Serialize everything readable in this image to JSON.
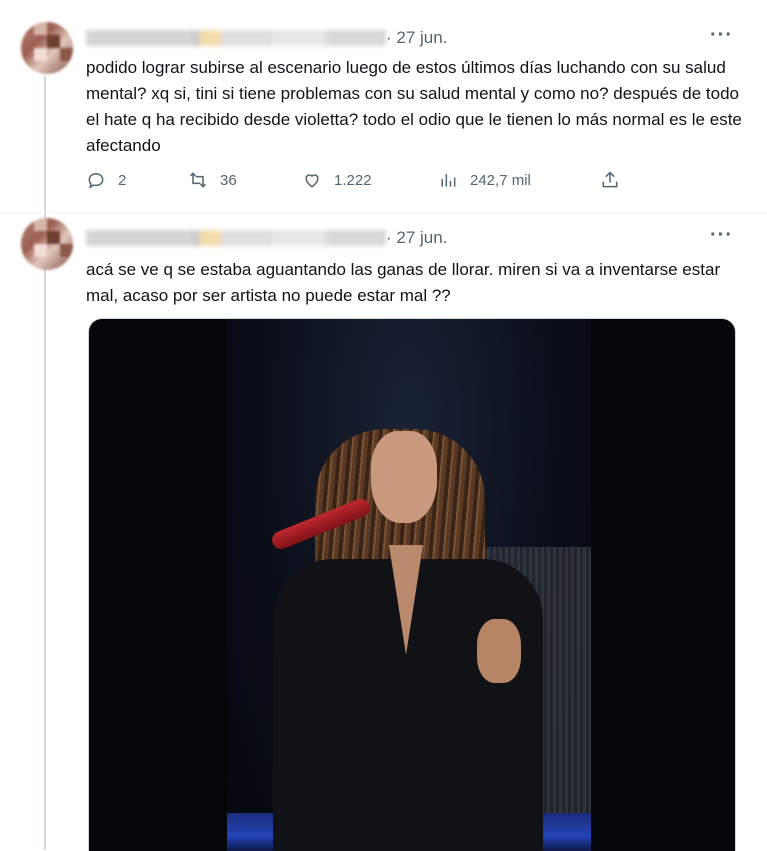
{
  "tweets": [
    {
      "date": "· 27 jun.",
      "more": "···",
      "text": "podido lograr subirse al escenario luego de estos últimos días luchando con su salud mental? xq si, tini si tiene problemas con su salud mental y como no? después de todo el hate q ha recibido desde violetta? todo el odio que le tienen lo más normal es le este afectando",
      "stats": {
        "replies": "2",
        "retweets": "36",
        "likes": "1.222",
        "views": "242,7 mil"
      }
    },
    {
      "date": "· 27 jun.",
      "more": "···",
      "text": "acá se ve q se estaba aguantando las ganas de llorar. miren si va a inventarse estar mal, acaso por ser artista no puede estar mal ??"
    }
  ],
  "icons": {
    "reply": "reply-icon",
    "retweet": "retweet-icon",
    "like": "heart-icon",
    "views": "views-chart-icon",
    "share": "share-icon"
  },
  "colors": {
    "text": "#0f1419",
    "secondary": "#536471",
    "border": "#cfd9de"
  }
}
